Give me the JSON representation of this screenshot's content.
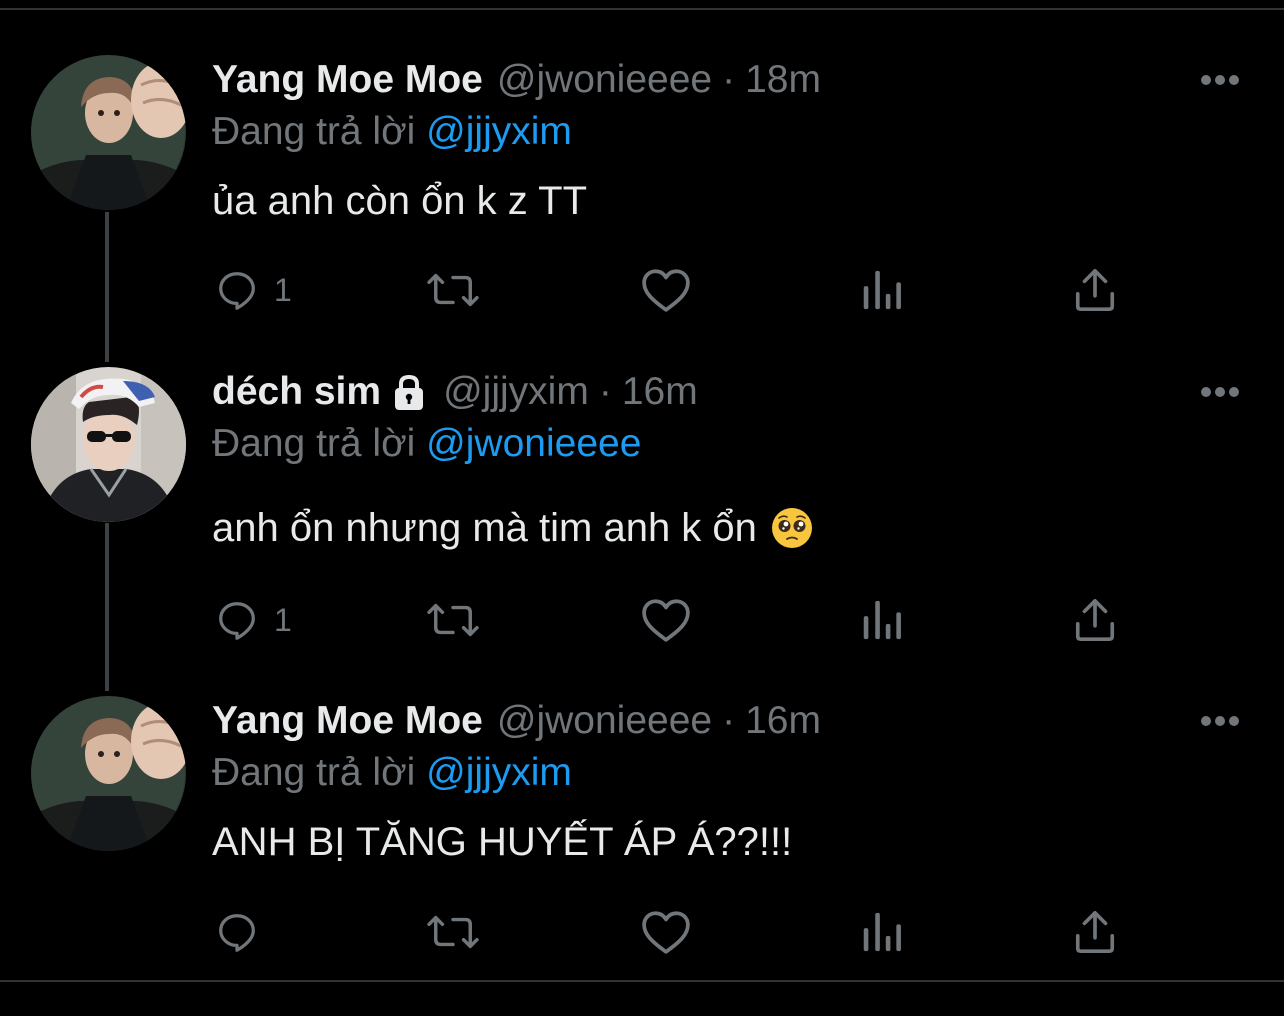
{
  "colors": {
    "background": "#000000",
    "text_primary": "#e7e9ea",
    "text_secondary": "#71767b",
    "link": "#1d9bf0",
    "thread_line": "#3e4144"
  },
  "tweets": [
    {
      "name": "Yang Moe Moe",
      "handle": "@jwonieeee",
      "separator": "·",
      "time": "18m",
      "reply_prefix": "Đang trả lời",
      "reply_to": "@jjjyxim",
      "text": "ủa anh còn ổn k z TT",
      "reply_count": "1",
      "icons": [
        "more-icon",
        "reply-icon",
        "retweet-icon",
        "like-icon",
        "analytics-icon",
        "share-icon"
      ]
    },
    {
      "name": "déch sim",
      "handle": "@jjjyxim",
      "separator": "·",
      "time": "16m",
      "reply_prefix": "Đang trả lời",
      "reply_to": "@jwonieeee",
      "text": "anh ổn nhưng mà tim anh k ổn",
      "reply_count": "1",
      "icons": [
        "lock-icon",
        "pleading-face-emoji",
        "more-icon",
        "reply-icon",
        "retweet-icon",
        "like-icon",
        "analytics-icon",
        "share-icon"
      ]
    },
    {
      "name": "Yang Moe Moe",
      "handle": "@jwonieeee",
      "separator": "·",
      "time": "16m",
      "reply_prefix": "Đang trả lời",
      "reply_to": "@jjjyxim",
      "text": "ANH BỊ TĂNG HUYẾT ÁP Á??!!!",
      "reply_count": "",
      "icons": [
        "more-icon",
        "reply-icon",
        "retweet-icon",
        "like-icon",
        "analytics-icon",
        "share-icon"
      ]
    }
  ]
}
